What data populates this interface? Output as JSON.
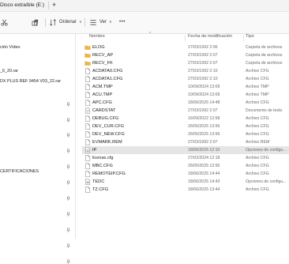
{
  "window": {
    "title": "Disco extraíble (E:)",
    "new_tab_glyph": "+"
  },
  "toolbar": {
    "sort_label": "Ordenar",
    "view_label": "Ver",
    "more_glyph": "•••",
    "caret_glyph": "∨"
  },
  "sidebar": {
    "items": [
      {
        "label": "ción Vídeo"
      },
      {
        "label": "_6_20.rar"
      },
      {
        "label": "DX PLUS REF 9454 V03_22.rar"
      },
      {
        "label": "CERTIFICACIONES"
      }
    ]
  },
  "columns": {
    "name": "Nombre",
    "date": "Fecha de modificación",
    "type": "Tipo",
    "sort_glyph": "^"
  },
  "files": [
    {
      "name": "ELOG",
      "date": "27/03/1992 2:06",
      "type": "Carpeta de archivos",
      "icon": "folder-icon",
      "color": "#e8b64c"
    },
    {
      "name": "RECV_AP",
      "date": "27/03/1992 2:07",
      "type": "Carpeta de archivos",
      "icon": "folder-icon",
      "color": "#e8b64c"
    },
    {
      "name": "RECV_FK",
      "date": "27/03/1992 2:07",
      "type": "Carpeta de archivos",
      "icon": "folder-icon",
      "color": "#e8b64c"
    },
    {
      "name": "ACDATA0.CFG",
      "date": "27/03/1992 2:10",
      "type": "Archivo CFG",
      "icon": "file-icon"
    },
    {
      "name": "ACDATA1.CFG",
      "date": "27/03/1992 2:10",
      "type": "Archivo CFG",
      "icon": "file-icon"
    },
    {
      "name": "ACM.TMP",
      "date": "10/09/2024 13:09",
      "type": "Archivo TMP",
      "icon": "file-icon"
    },
    {
      "name": "ACU.TMP",
      "date": "10/09/2024 13:09",
      "type": "Archivo TMP",
      "icon": "file-icon"
    },
    {
      "name": "APC.CFG",
      "date": "18/06/2025 14:48",
      "type": "Archivo CFG",
      "icon": "file-icon"
    },
    {
      "name": "CARDSTAT",
      "date": "27/03/1992 2:07",
      "type": "Documento de texto",
      "icon": "text-file-icon"
    },
    {
      "name": "DEBUG.CFG",
      "date": "16/09/2022 12:58",
      "type": "Archivo CFG",
      "icon": "file-icon"
    },
    {
      "name": "DEV_CUR.CFG",
      "date": "26/05/2025 13:56",
      "type": "Archivo CFG",
      "icon": "file-icon"
    },
    {
      "name": "DEV_NEW.CFG",
      "date": "26/05/2025 13:56",
      "type": "Archivo CFG",
      "icon": "file-icon"
    },
    {
      "name": "EVMARK.REM",
      "date": "27/03/1992 2:07",
      "type": "Archivo REM",
      "icon": "file-icon"
    },
    {
      "name": "IP",
      "date": "18/06/2025 12:10",
      "type": "Opciones de configu...",
      "icon": "settings-file-icon",
      "selected": true
    },
    {
      "name": "license.cfg",
      "date": "27/02/2024 12:18",
      "type": "Archivo CFG",
      "icon": "file-icon"
    },
    {
      "name": "MBC.CFG",
      "date": "26/05/2025 13:56",
      "type": "Archivo CFG",
      "icon": "file-icon"
    },
    {
      "name": "REMOTEIP.CFG",
      "date": "18/06/2025 14:44",
      "type": "Archivo CFG",
      "icon": "file-icon"
    },
    {
      "name": "TEDC",
      "date": "18/06/2025 14:43",
      "type": "Opciones de configu...",
      "icon": "settings-file-icon"
    },
    {
      "name": "TZ.CFG",
      "date": "18/06/2025 13:44",
      "type": "Archivo CFG",
      "icon": "file-icon"
    }
  ]
}
